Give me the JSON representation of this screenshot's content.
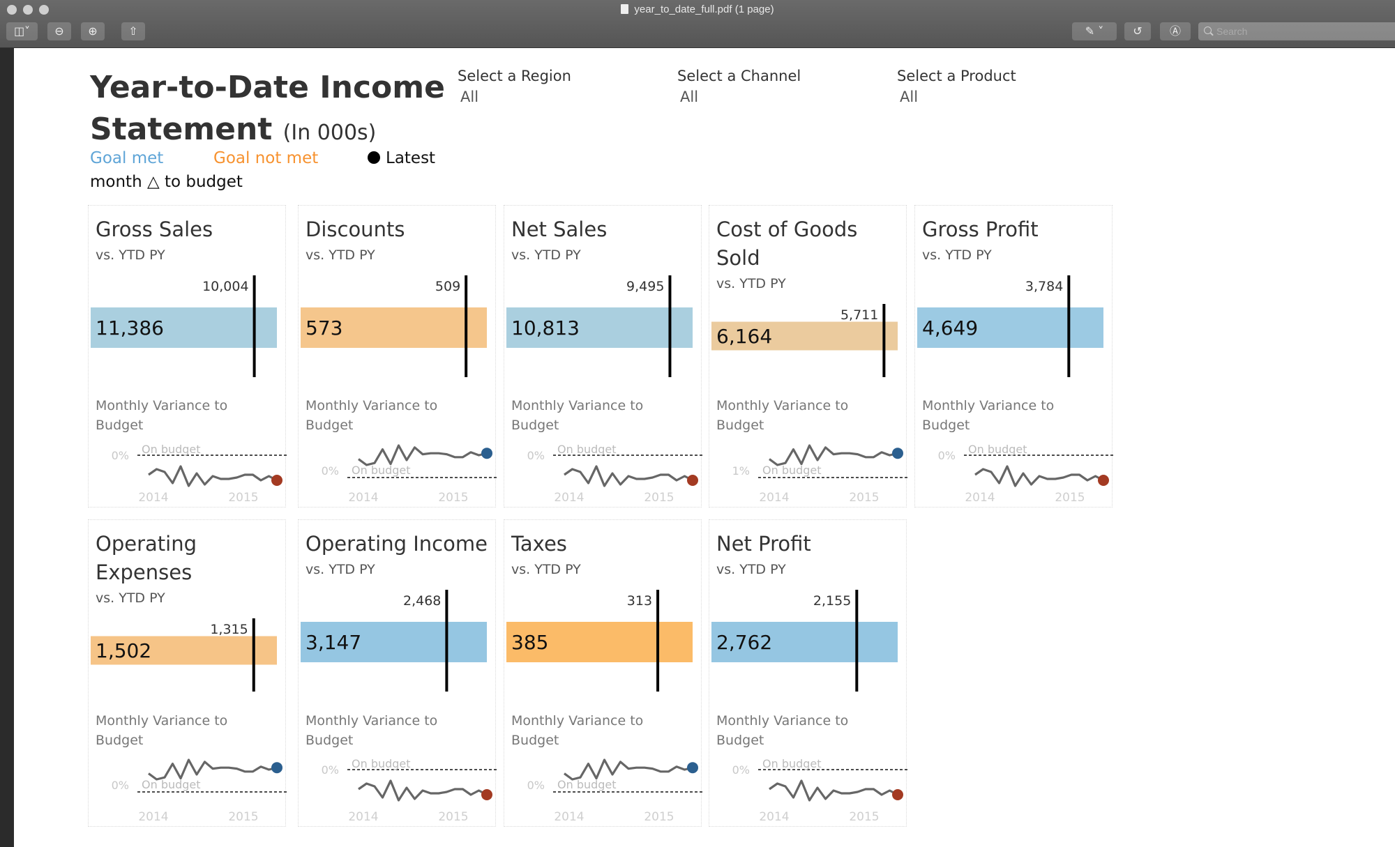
{
  "window": {
    "title": "year_to_date_full.pdf (1 page)",
    "search_placeholder": "Search",
    "toolbar": [
      "sidebar-toggle",
      "zoom-out",
      "zoom-in",
      "share",
      "markup",
      "rotate",
      "annotate"
    ]
  },
  "dashboard": {
    "title": "Year-to-Date Income Statement",
    "title_suffix": "(In 000s)",
    "legend": {
      "goal_met": "Goal met",
      "goal_not_met": "Goal not met",
      "latest": "Latest",
      "note": "month △ to budget"
    },
    "colors": {
      "goal_met": "#6aaed6",
      "goal_not_met": "#f79d3a",
      "latest_good": "#2b5f8f",
      "latest_bad": "#a33a22"
    },
    "filters": [
      {
        "label": "Select a Region",
        "value": "All"
      },
      {
        "label": "Select a Channel",
        "value": "All"
      },
      {
        "label": "Select a Product",
        "value": "All"
      }
    ]
  },
  "card_labels": {
    "subtitle": "vs. YTD PY",
    "variance_title": "Monthly Variance to Budget",
    "on_budget": "On budget",
    "years": [
      "2014",
      "2015"
    ]
  },
  "chart_data": [
    {
      "type": "bar",
      "title": "Gross Sales",
      "current": 11386,
      "current_label": "11,386",
      "prior": 10004,
      "prior_label": "10,004",
      "status": "goal_met",
      "bar_color": "#aacfdf",
      "spark": {
        "type": "line",
        "axis_label": "0%",
        "line_position": "below",
        "latest": "bad",
        "values": [
          -1.0,
          -0.6,
          -0.8,
          -1.6,
          -0.4,
          -1.8,
          -0.9,
          -1.7,
          -1.1,
          -1.3,
          -1.3,
          -1.2,
          -1.0,
          -1.0,
          -1.4,
          -1.1,
          -1.4
        ]
      }
    },
    {
      "type": "bar",
      "title": "Discounts",
      "current": 573,
      "current_label": "573",
      "prior": 509,
      "prior_label": "509",
      "status": "goal_not_met",
      "bar_color": "#f5c68c",
      "spark": {
        "type": "line",
        "axis_label": "0%",
        "line_position": "above",
        "latest": "good",
        "values": [
          1.4,
          0.8,
          1.0,
          2.4,
          0.9,
          2.8,
          1.3,
          2.6,
          1.9,
          2.0,
          2.0,
          1.9,
          1.6,
          1.6,
          2.1,
          1.8,
          2.0
        ]
      }
    },
    {
      "type": "bar",
      "title": "Net Sales",
      "current": 10813,
      "current_label": "10,813",
      "prior": 9495,
      "prior_label": "9,495",
      "status": "goal_met",
      "bar_color": "#aacfdf",
      "spark": {
        "type": "line",
        "axis_label": "0%",
        "line_position": "below",
        "latest": "bad",
        "values": [
          -1.0,
          -0.6,
          -0.8,
          -1.6,
          -0.4,
          -1.8,
          -0.9,
          -1.7,
          -1.1,
          -1.3,
          -1.3,
          -1.2,
          -1.0,
          -1.0,
          -1.4,
          -1.1,
          -1.4
        ]
      }
    },
    {
      "type": "bar",
      "title": "Cost of Goods Sold",
      "current": 6164,
      "current_label": "6,164",
      "prior": 5711,
      "prior_label": "5,711",
      "status": "goal_not_met",
      "bar_color": "#ebcb9e",
      "spark": {
        "type": "line",
        "axis_label": "1%",
        "line_position": "above",
        "latest": "good",
        "values": [
          1.4,
          0.8,
          1.0,
          2.4,
          0.9,
          2.8,
          1.3,
          2.6,
          1.9,
          2.0,
          2.0,
          1.9,
          1.6,
          1.6,
          2.1,
          1.8,
          2.0
        ]
      }
    },
    {
      "type": "bar",
      "title": "Gross Profit",
      "current": 4649,
      "current_label": "4,649",
      "prior": 3784,
      "prior_label": "3,784",
      "status": "goal_met",
      "bar_color": "#9ccae3",
      "spark": {
        "type": "line",
        "axis_label": "0%",
        "line_position": "below",
        "latest": "bad",
        "values": [
          -1.0,
          -0.6,
          -0.8,
          -1.6,
          -0.4,
          -1.8,
          -0.9,
          -1.7,
          -1.1,
          -1.3,
          -1.3,
          -1.2,
          -1.0,
          -1.0,
          -1.4,
          -1.1,
          -1.4
        ]
      }
    },
    {
      "type": "bar",
      "title": "Operating Expenses",
      "current": 1502,
      "current_label": "1,502",
      "prior": 1315,
      "prior_label": "1,315",
      "status": "goal_not_met",
      "bar_color": "#f6c487",
      "spark": {
        "type": "line",
        "axis_label": "0%",
        "line_position": "above",
        "latest": "good",
        "values": [
          1.4,
          0.8,
          1.0,
          2.4,
          0.9,
          2.8,
          1.3,
          2.6,
          1.9,
          2.0,
          2.0,
          1.9,
          1.6,
          1.6,
          2.1,
          1.8,
          2.0
        ]
      }
    },
    {
      "type": "bar",
      "title": "Operating Income",
      "current": 3147,
      "current_label": "3,147",
      "prior": 2468,
      "prior_label": "2,468",
      "status": "goal_met",
      "bar_color": "#95c6e2",
      "spark": {
        "type": "line",
        "axis_label": "0%",
        "line_position": "below",
        "latest": "bad",
        "values": [
          -1.0,
          -0.6,
          -0.8,
          -1.6,
          -0.4,
          -1.8,
          -0.9,
          -1.7,
          -1.1,
          -1.3,
          -1.3,
          -1.2,
          -1.0,
          -1.0,
          -1.4,
          -1.1,
          -1.4
        ]
      }
    },
    {
      "type": "bar",
      "title": "Taxes",
      "current": 385,
      "current_label": "385",
      "prior": 313,
      "prior_label": "313",
      "status": "goal_not_met",
      "bar_color": "#fbbb68",
      "spark": {
        "type": "line",
        "axis_label": "0%",
        "line_position": "above",
        "latest": "good",
        "values": [
          1.4,
          0.8,
          1.0,
          2.4,
          0.9,
          2.8,
          1.3,
          2.6,
          1.9,
          2.0,
          2.0,
          1.9,
          1.6,
          1.6,
          2.1,
          1.8,
          2.0
        ]
      }
    },
    {
      "type": "bar",
      "title": "Net Profit",
      "current": 2762,
      "current_label": "2,762",
      "prior": 2155,
      "prior_label": "2,155",
      "status": "goal_met",
      "bar_color": "#95c6e2",
      "spark": {
        "type": "line",
        "axis_label": "0%",
        "line_position": "below",
        "latest": "bad",
        "values": [
          -1.0,
          -0.6,
          -0.8,
          -1.6,
          -0.4,
          -1.8,
          -0.9,
          -1.7,
          -1.1,
          -1.3,
          -1.3,
          -1.2,
          -1.0,
          -1.0,
          -1.4,
          -1.1,
          -1.4
        ]
      }
    }
  ]
}
